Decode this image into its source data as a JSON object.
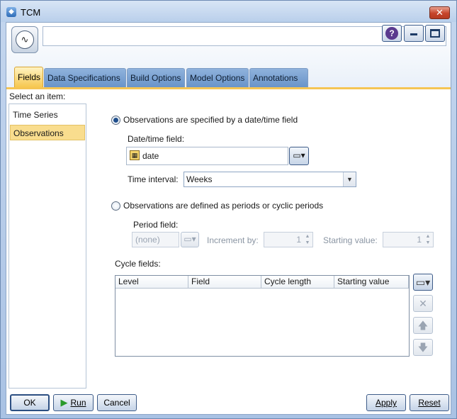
{
  "window": {
    "title": "TCM",
    "close_label": "✕"
  },
  "header": {
    "node_name": ""
  },
  "tabs": [
    {
      "label": "Fields",
      "active": true
    },
    {
      "label": "Data Specifications",
      "active": false
    },
    {
      "label": "Build Options",
      "active": false
    },
    {
      "label": "Model Options",
      "active": false
    },
    {
      "label": "Annotations",
      "active": false
    }
  ],
  "sidebar": {
    "label": "Select an item:",
    "items": [
      {
        "label": "Time Series",
        "selected": false
      },
      {
        "label": "Observations",
        "selected": true
      }
    ]
  },
  "observations": {
    "option_date": {
      "label": "Observations are specified by a date/time field",
      "checked": true
    },
    "date_field_label": "Date/time field:",
    "date_field_value": "date",
    "time_interval_label": "Time interval:",
    "time_interval_value": "Weeks",
    "option_periods": {
      "label": "Observations are defined as periods or cyclic periods",
      "checked": false
    },
    "period_field_label": "Period field:",
    "period_field_value": "(none)",
    "increment_label": "Increment by:",
    "increment_value": "1",
    "starting_label": "Starting value:",
    "starting_value": "1",
    "cycle_fields_label": "Cycle fields:",
    "cycle_columns": [
      "Level",
      "Field",
      "Cycle length",
      "Starting value"
    ]
  },
  "footer": {
    "ok": "OK",
    "run": "Run",
    "cancel": "Cancel",
    "apply": "Apply",
    "reset": "Reset"
  },
  "colors": {
    "active_tab": "#f6c64b",
    "selection": "#f9dd8e",
    "frame": "#a9c2e4"
  }
}
